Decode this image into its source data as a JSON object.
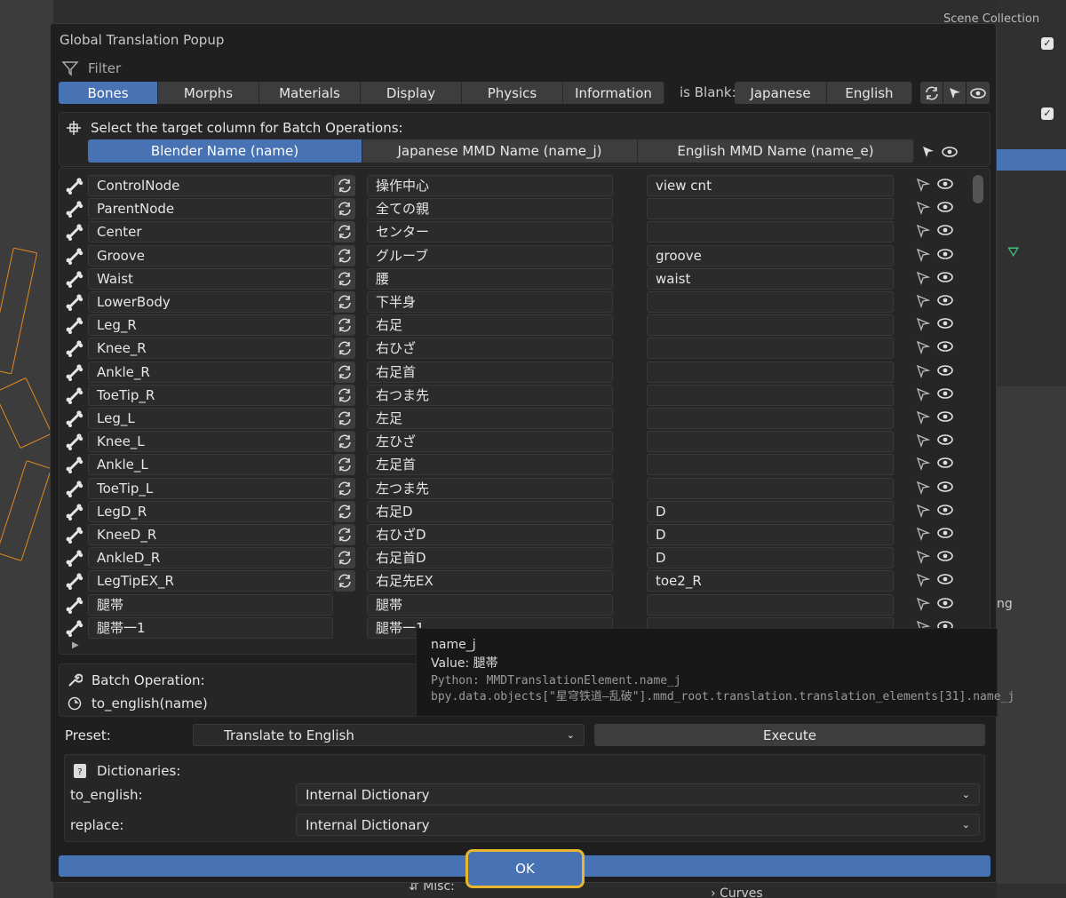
{
  "popup": {
    "title": "Global Translation Popup",
    "filter_label": "Filter",
    "tabs": [
      "Bones",
      "Morphs",
      "Materials",
      "Display",
      "Physics",
      "Information"
    ],
    "active_tab": "Bones",
    "is_blank_label": "is Blank:",
    "blank_langs": [
      "Japanese",
      "English"
    ],
    "target_label": "Select the target column for Batch Operations:",
    "columns": [
      "Blender Name (name)",
      "Japanese MMD Name (name_j)",
      "English MMD Name (name_e)"
    ],
    "active_column": "Blender Name (name)"
  },
  "rows": [
    {
      "name": "ControlNode",
      "name_j": "操作中心",
      "name_e": "view cnt",
      "sync": true
    },
    {
      "name": "ParentNode",
      "name_j": "全ての親",
      "name_e": "",
      "sync": true
    },
    {
      "name": "Center",
      "name_j": "センター",
      "name_e": "",
      "sync": true
    },
    {
      "name": "Groove",
      "name_j": "グルーブ",
      "name_e": "groove",
      "sync": true
    },
    {
      "name": "Waist",
      "name_j": "腰",
      "name_e": "waist",
      "sync": true
    },
    {
      "name": "LowerBody",
      "name_j": "下半身",
      "name_e": "",
      "sync": true
    },
    {
      "name": "Leg_R",
      "name_j": "右足",
      "name_e": "",
      "sync": true
    },
    {
      "name": "Knee_R",
      "name_j": "右ひざ",
      "name_e": "",
      "sync": true
    },
    {
      "name": "Ankle_R",
      "name_j": "右足首",
      "name_e": "",
      "sync": true
    },
    {
      "name": "ToeTip_R",
      "name_j": "右つま先",
      "name_e": "",
      "sync": true
    },
    {
      "name": "Leg_L",
      "name_j": "左足",
      "name_e": "",
      "sync": true
    },
    {
      "name": "Knee_L",
      "name_j": "左ひざ",
      "name_e": "",
      "sync": true
    },
    {
      "name": "Ankle_L",
      "name_j": "左足首",
      "name_e": "",
      "sync": true
    },
    {
      "name": "ToeTip_L",
      "name_j": "左つま先",
      "name_e": "",
      "sync": true
    },
    {
      "name": "LegD_R",
      "name_j": "右足D",
      "name_e": "D",
      "sync": true
    },
    {
      "name": "KneeD_R",
      "name_j": "右ひざD",
      "name_e": "D",
      "sync": true
    },
    {
      "name": "AnkleD_R",
      "name_j": "右足首D",
      "name_e": "D",
      "sync": true
    },
    {
      "name": "LegTipEX_R",
      "name_j": "右足先EX",
      "name_e": "toe2_R",
      "sync": true
    },
    {
      "name": "腿帯",
      "name_j": "腿帯",
      "name_e": "",
      "sync": false
    },
    {
      "name": "腿帯一1",
      "name_j": "腿帯一1",
      "name_e": "",
      "sync": false
    }
  ],
  "tooltip": {
    "line1": "name_j",
    "line2": "Value: 腿帯",
    "line3": "Python: MMDTranslationElement.name_j",
    "line4": "bpy.data.objects[\"星穹铁道—乱破\"].mmd_root.translation.translation_elements[31].name_j"
  },
  "batch": {
    "label": "Batch Operation:",
    "expression": "to_english(name)",
    "preset_label": "Preset:",
    "preset_value": "Translate to English",
    "execute_label": "Execute"
  },
  "dicts": {
    "label": "Dictionaries:",
    "to_english_label": "to_english:",
    "to_english_value": "Internal Dictionary",
    "replace_label": "replace:",
    "replace_value": "Internal Dictionary"
  },
  "ok_label": "OK",
  "background": {
    "scene_collection": "Scene Collection",
    "misc": "Misc:",
    "curves": "Curves",
    "ng": "ng"
  },
  "colors": {
    "accent": "#4772b3",
    "highlight": "#e8b730",
    "skeleton": "#e08a1e"
  }
}
